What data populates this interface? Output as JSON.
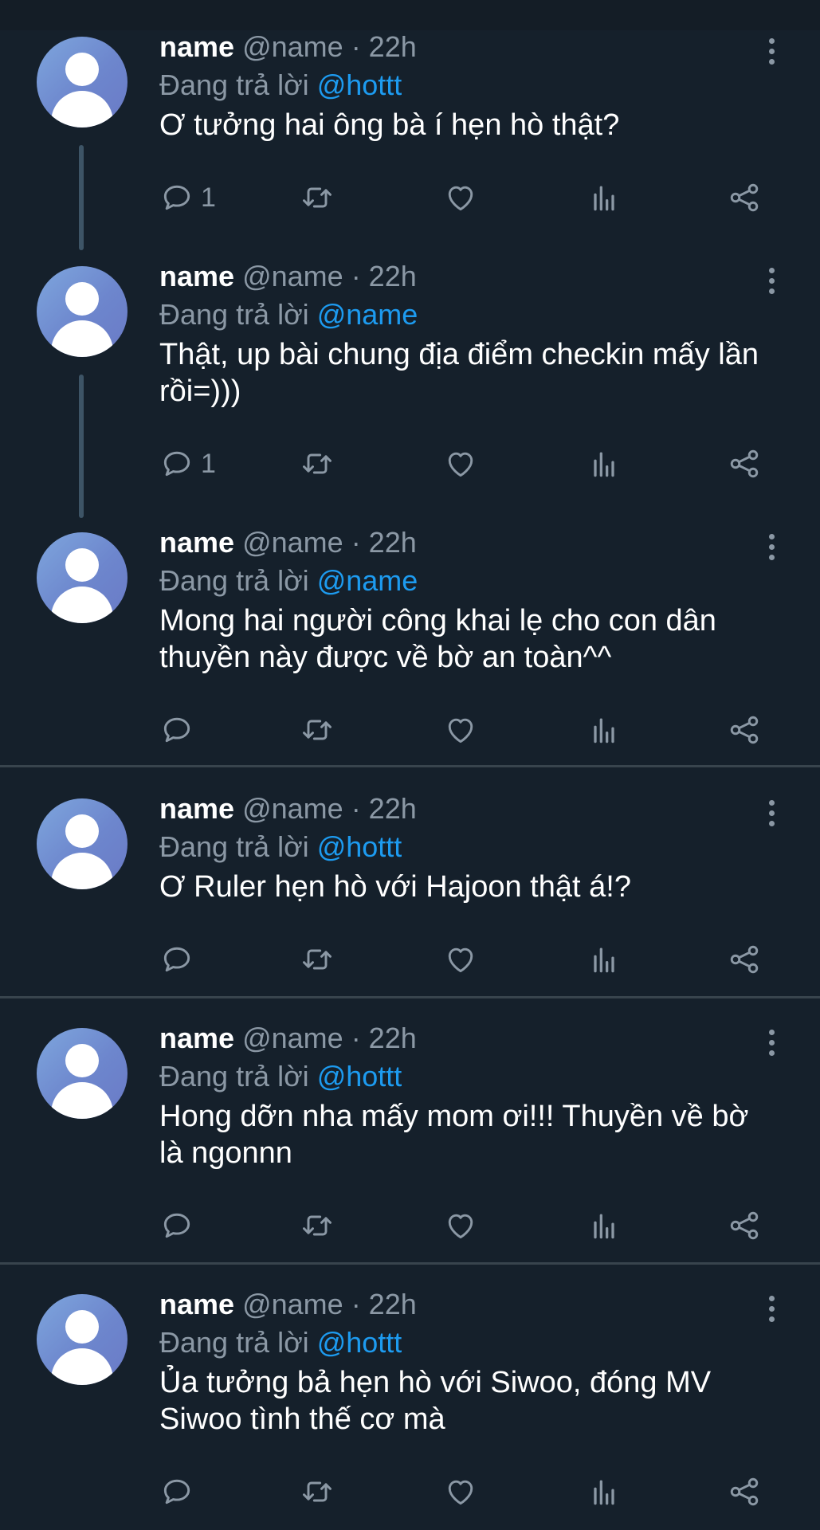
{
  "tweets": [
    {
      "name": "name",
      "handle": "@name",
      "time": "· 22h",
      "reply_prefix": "Đang trả lời",
      "mention": "@hottt",
      "text": "Ơ tưởng hai ông bà í hẹn hò thật?",
      "reply_count": "1"
    },
    {
      "name": "name",
      "handle": "@name",
      "time": "· 22h",
      "reply_prefix": "Đang trả lời",
      "mention": "@name",
      "text": "Thật, up bài chung địa điểm checkin mấy lần\nrồi=)))",
      "reply_count": "1"
    },
    {
      "name": "name",
      "handle": "@name",
      "time": "· 22h",
      "reply_prefix": "Đang trả lời",
      "mention": "@name",
      "text": "Mong hai người công khai lẹ cho con dân\nthuyền này được về bờ an toàn^^",
      "reply_count": ""
    },
    {
      "name": "name",
      "handle": "@name",
      "time": "· 22h",
      "reply_prefix": "Đang trả lời",
      "mention": "@hottt",
      "text": "Ơ Ruler hẹn hò với Hajoon thật á!?",
      "reply_count": ""
    },
    {
      "name": "name",
      "handle": "@name",
      "time": "· 22h",
      "reply_prefix": "Đang trả lời",
      "mention": "@hottt",
      "text": "Hong dỡn nha mấy mom ơi!!! Thuyền về bờ\nlà ngonnn",
      "reply_count": ""
    },
    {
      "name": "name",
      "handle": "@name",
      "time": "· 22h",
      "reply_prefix": "Đang trả lời",
      "mention": "@hottt",
      "text": "Ủa tưởng bả hẹn hò với Siwoo, đóng MV\nSiwoo tình thế cơ mà",
      "reply_count": ""
    }
  ],
  "icons": {
    "reply": "reply-icon",
    "retweet": "retweet-icon",
    "like": "heart-icon",
    "views": "analytics-icon",
    "share": "share-icon",
    "more": "more-vertical-icon"
  },
  "colors": {
    "background": "#15202b",
    "mention": "#1d9bf0",
    "muted": "#8b98a5",
    "divider": "#38444d",
    "thread_line": "#3d5466"
  }
}
